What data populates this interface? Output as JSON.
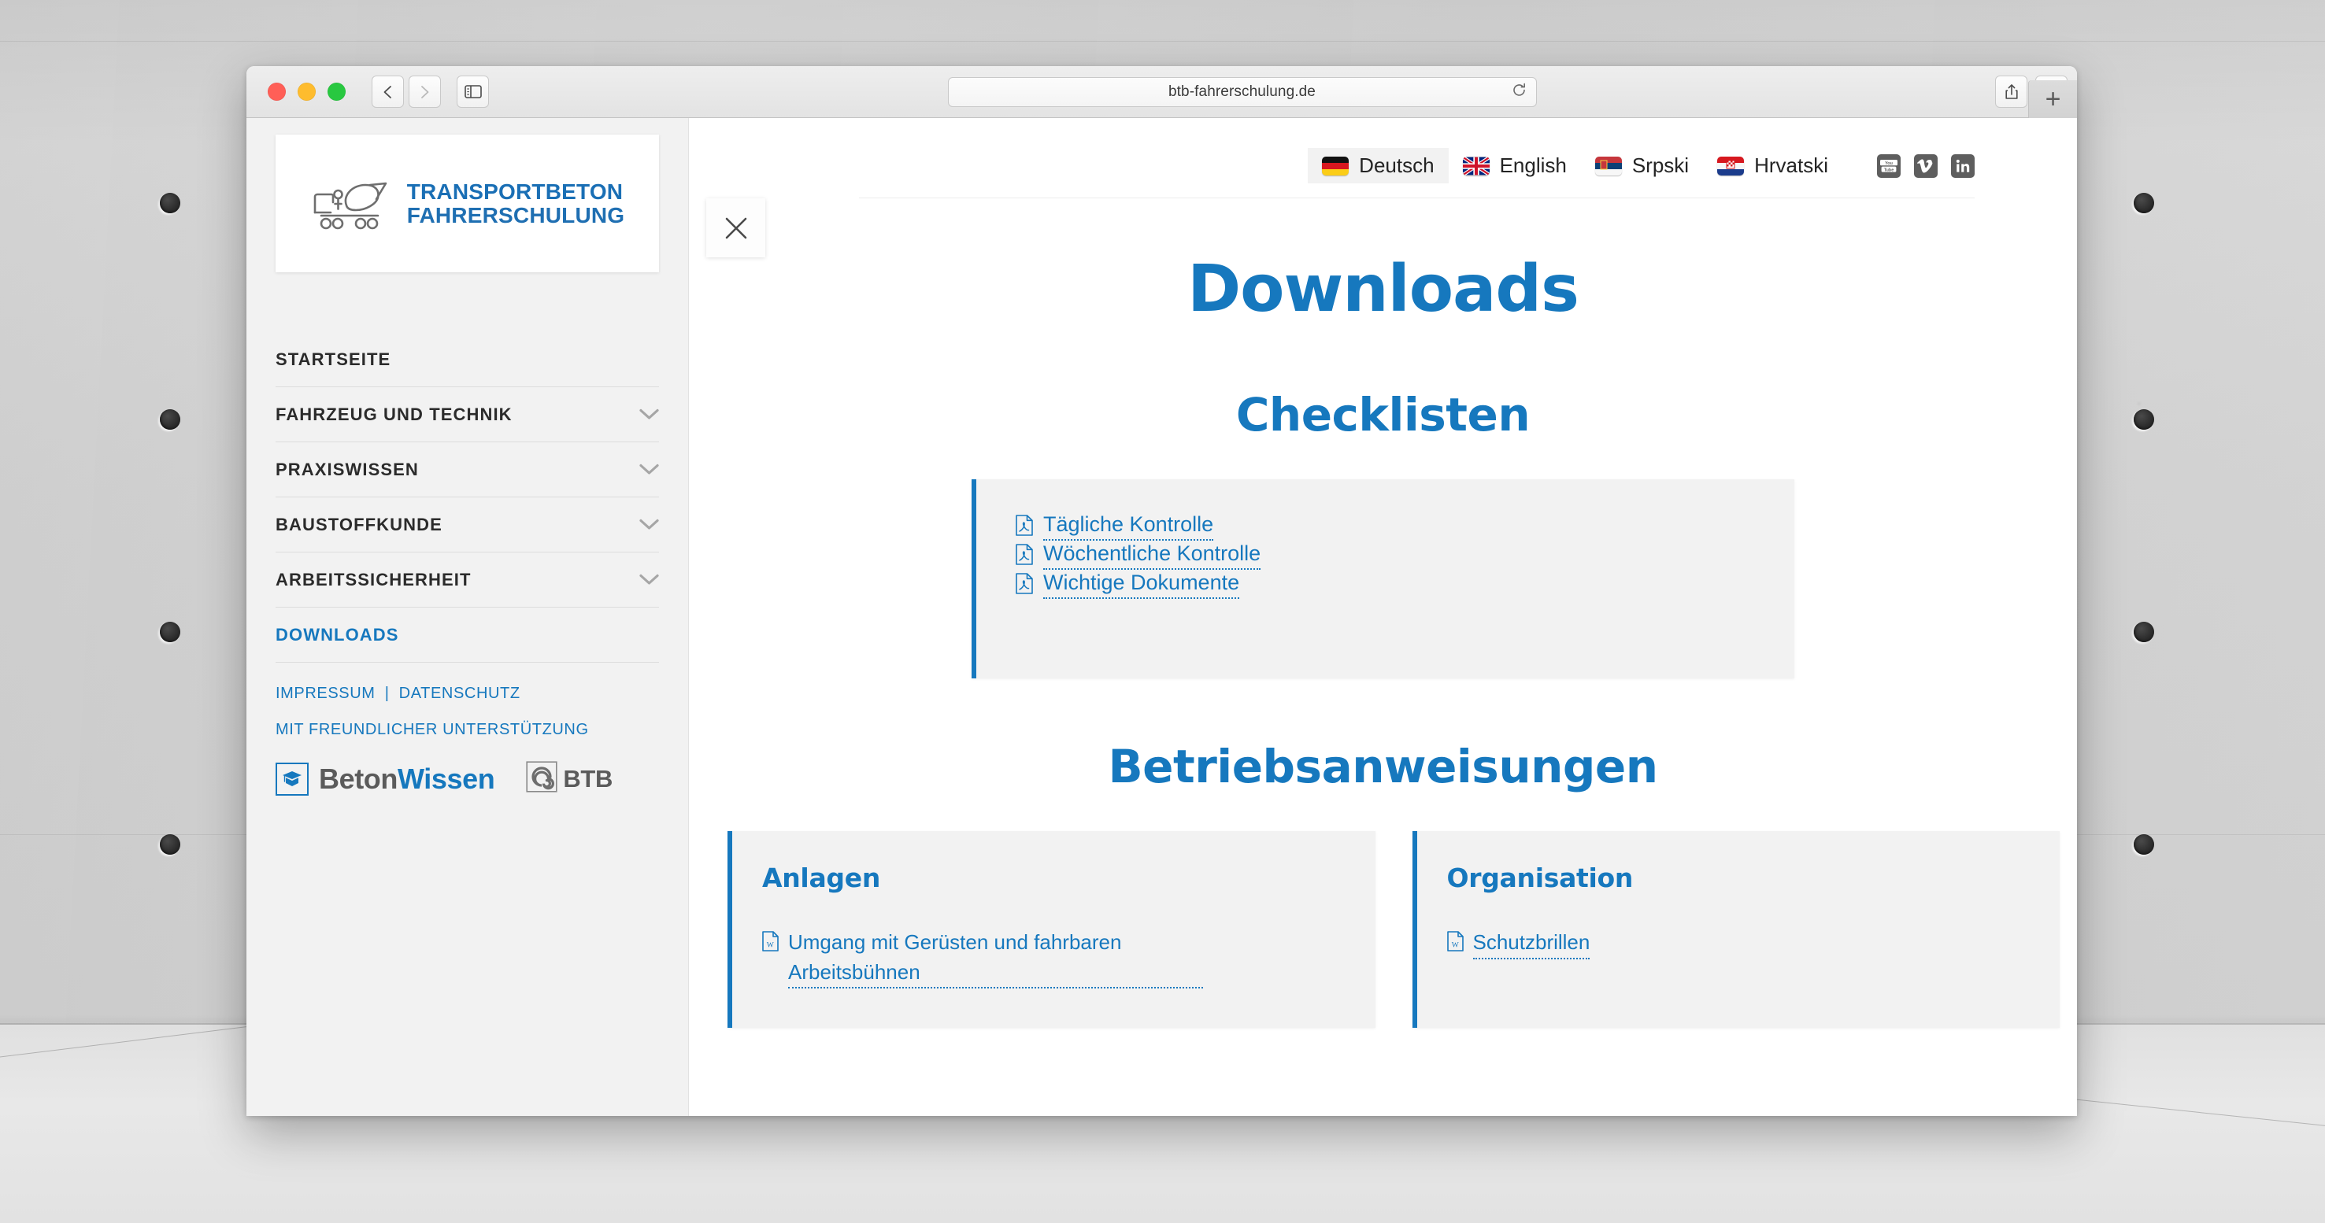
{
  "browser": {
    "url": "btb-fahrerschulung.de",
    "back_label": "Back",
    "forward_label": "Forward",
    "sidebar_toggle_label": "Show Sidebar",
    "reload_label": "Reload",
    "share_label": "Share",
    "tab_overview_label": "Tab Overview",
    "new_tab_label": "+"
  },
  "sidebar": {
    "logo": {
      "line1": "TRANSPORTBETON",
      "line2": "FAHRERSCHULUNG",
      "icon": "concrete-mixer-truck-icon"
    },
    "nav": [
      {
        "label": "STARTSEITE",
        "expandable": false,
        "active": false
      },
      {
        "label": "FAHRZEUG UND TECHNIK",
        "expandable": true,
        "active": false
      },
      {
        "label": "PRAXISWISSEN",
        "expandable": true,
        "active": false
      },
      {
        "label": "BAUSTOFFKUNDE",
        "expandable": true,
        "active": false
      },
      {
        "label": "ARBEITSSICHERHEIT",
        "expandable": true,
        "active": false
      },
      {
        "label": "DOWNLOADS",
        "expandable": false,
        "active": true
      }
    ],
    "meta": {
      "impressum": "IMPRESSUM",
      "separator": "|",
      "datenschutz": "DATENSCHUTZ",
      "support": "MIT FREUNDLICHER UNTERSTÜTZUNG"
    },
    "partners": [
      {
        "name_a": "Beton",
        "name_b": "Wissen",
        "icon": "graduation-cap-icon"
      },
      {
        "name": "BTB",
        "icon": "btb-spiral-icon"
      }
    ]
  },
  "content": {
    "close_label": "×",
    "languages": [
      {
        "label": "Deutsch",
        "flag": "flag-de",
        "active": true
      },
      {
        "label": "English",
        "flag": "flag-gb",
        "active": false
      },
      {
        "label": "Srpski",
        "flag": "flag-rs",
        "active": false
      },
      {
        "label": "Hrvatski",
        "flag": "flag-hr",
        "active": false
      }
    ],
    "socials": [
      {
        "name": "youtube-icon",
        "label": "YouTube"
      },
      {
        "name": "vimeo-icon",
        "label": "Vimeo"
      },
      {
        "name": "linkedin-icon",
        "label": "LinkedIn"
      }
    ],
    "page_title": "Downloads",
    "sections": [
      {
        "title": "Checklisten",
        "links": [
          {
            "label": "Tägliche Kontrolle",
            "type": "pdf"
          },
          {
            "label": "Wöchentliche Kontrolle",
            "type": "pdf"
          },
          {
            "label": "Wichtige Dokumente",
            "type": "pdf"
          }
        ]
      },
      {
        "title": "Betriebsanweisungen",
        "columns": [
          {
            "heading": "Anlagen",
            "links": [
              {
                "label": "Umgang mit Gerüsten und fahrbaren Arbeitsbühnen",
                "type": "word"
              }
            ]
          },
          {
            "heading": "Organisation",
            "links": [
              {
                "label": "Schutzbrillen",
                "type": "word"
              }
            ]
          }
        ]
      }
    ]
  },
  "colors": {
    "brand_blue": "#1678be",
    "panel_gray": "#f2f2f2",
    "sidebar_gray": "#f2f2f2",
    "text_dark": "#2b2b2b"
  }
}
